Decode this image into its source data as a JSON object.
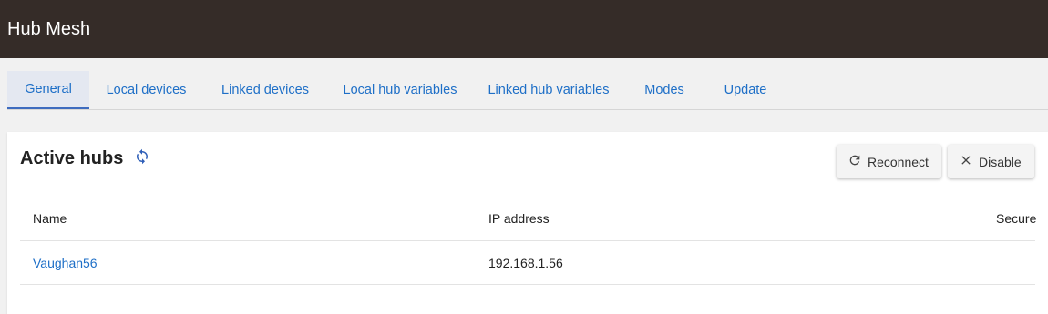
{
  "app": {
    "title": "Hub Mesh"
  },
  "tabs": [
    {
      "label": "General",
      "active": true
    },
    {
      "label": "Local devices"
    },
    {
      "label": "Linked devices"
    },
    {
      "label": "Local hub variables"
    },
    {
      "label": "Linked hub variables"
    },
    {
      "label": "Modes"
    },
    {
      "label": "Update"
    }
  ],
  "card": {
    "title": "Active hubs",
    "refresh_icon": "refresh-icon",
    "buttons": {
      "reconnect": {
        "label": "Reconnect",
        "icon": "reconnect-icon"
      },
      "disable": {
        "label": "Disable",
        "icon": "close-icon"
      }
    }
  },
  "table": {
    "columns": [
      "Name",
      "IP address",
      "Secure"
    ],
    "rows": [
      {
        "name": "Vaughan56",
        "ip": "192.168.1.56",
        "secure": ""
      }
    ]
  },
  "colors": {
    "appbar": "#352c28",
    "link": "#1e6fc7",
    "active_tab_bg": "#e4e8f1"
  }
}
